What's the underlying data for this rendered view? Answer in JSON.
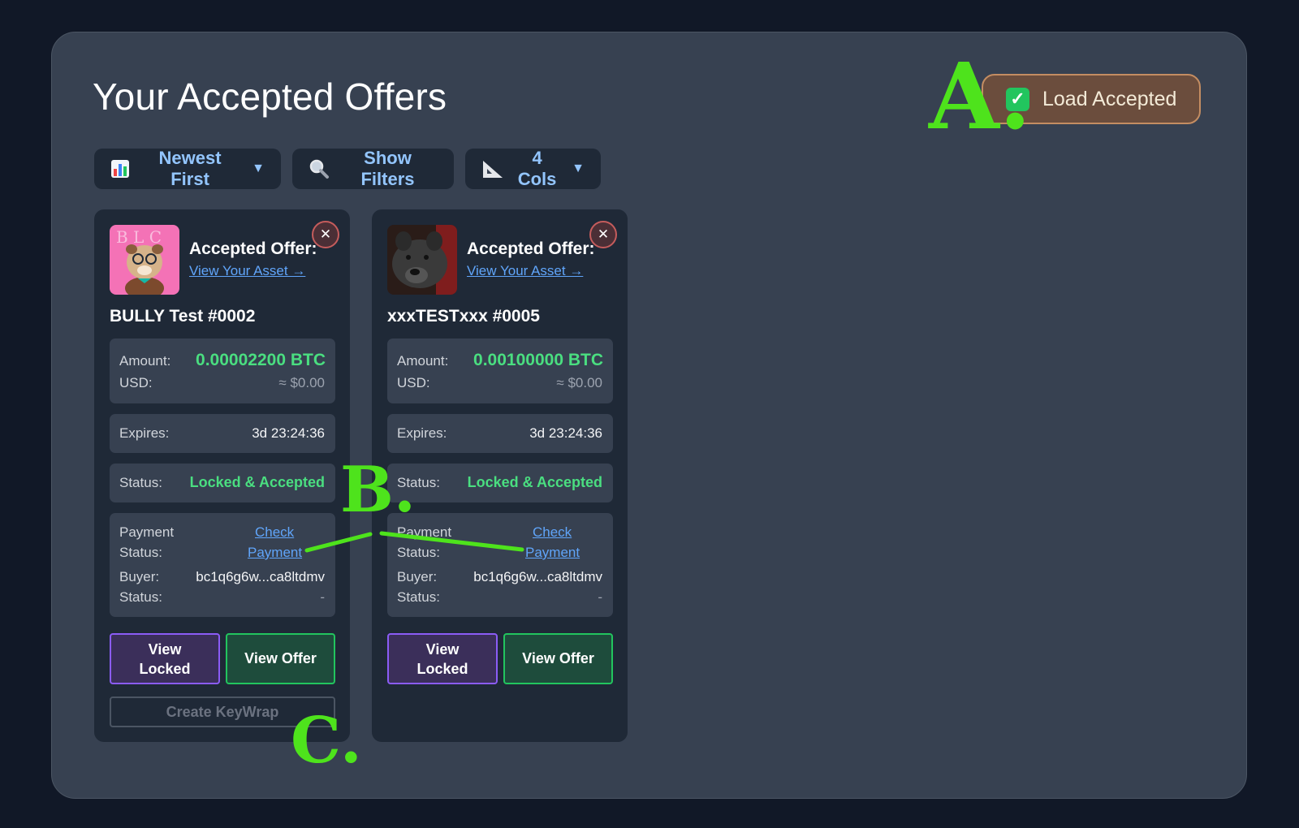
{
  "page": {
    "title": "Your Accepted Offers",
    "load_button": {
      "icon": "check-box-icon",
      "label": "Load Accepted"
    }
  },
  "toolbar": {
    "sort": {
      "icon": "bar-chart-icon",
      "label": "Newest First",
      "caret": "▼"
    },
    "filters": {
      "icon": "magnifier-icon",
      "label": "Show Filters"
    },
    "cols": {
      "icon": "triangle-ruler-icon",
      "label": "4 Cols",
      "caret": "▼"
    }
  },
  "cards": [
    {
      "heading": "Accepted Offer:",
      "asset_link": "View Your Asset →",
      "name": "BULLY Test #0002",
      "amount_label": "Amount:",
      "amount": "0.00002200 BTC",
      "usd_label": "USD:",
      "usd_value": "≈ $0.00",
      "expires_label": "Expires:",
      "expires_value": "3d 23:24:36",
      "status_label": "Status:",
      "status_value": "Locked & Accepted",
      "payment_label_1": "Payment",
      "payment_label_2": "Status:",
      "check_1": "Check",
      "check_2": "Payment",
      "buyer_label": "Buyer:",
      "buyer_value": "bc1q6g6w...ca8ltdmv",
      "buyer_status_label": "Status:",
      "buyer_status_value": "-",
      "view_locked_1": "View",
      "view_locked_2": "Locked",
      "view_offer": "View Offer",
      "keywrap": "Create KeyWrap"
    },
    {
      "heading": "Accepted Offer:",
      "asset_link": "View Your Asset →",
      "name": "xxxTESTxxx #0005",
      "amount_label": "Amount:",
      "amount": "0.00100000 BTC",
      "usd_label": "USD:",
      "usd_value": "≈ $0.00",
      "expires_label": "Expires:",
      "expires_value": "3d 23:24:36",
      "status_label": "Status:",
      "status_value": "Locked & Accepted",
      "payment_label_1": "Payment",
      "payment_label_2": "Status:",
      "check_1": "Check",
      "check_2": "Payment",
      "buyer_label": "Buyer:",
      "buyer_value": "bc1q6g6w...ca8ltdmv",
      "buyer_status_label": "Status:",
      "buyer_status_value": "-",
      "view_locked_1": "View",
      "view_locked_2": "Locked",
      "view_offer": "View Offer"
    }
  ],
  "annotations": {
    "a": "A.",
    "b": "B.",
    "c": "C."
  },
  "colors": {
    "accent_green": "#4ade80",
    "link_blue": "#60a5fa",
    "annotation": "#4ee31c"
  }
}
